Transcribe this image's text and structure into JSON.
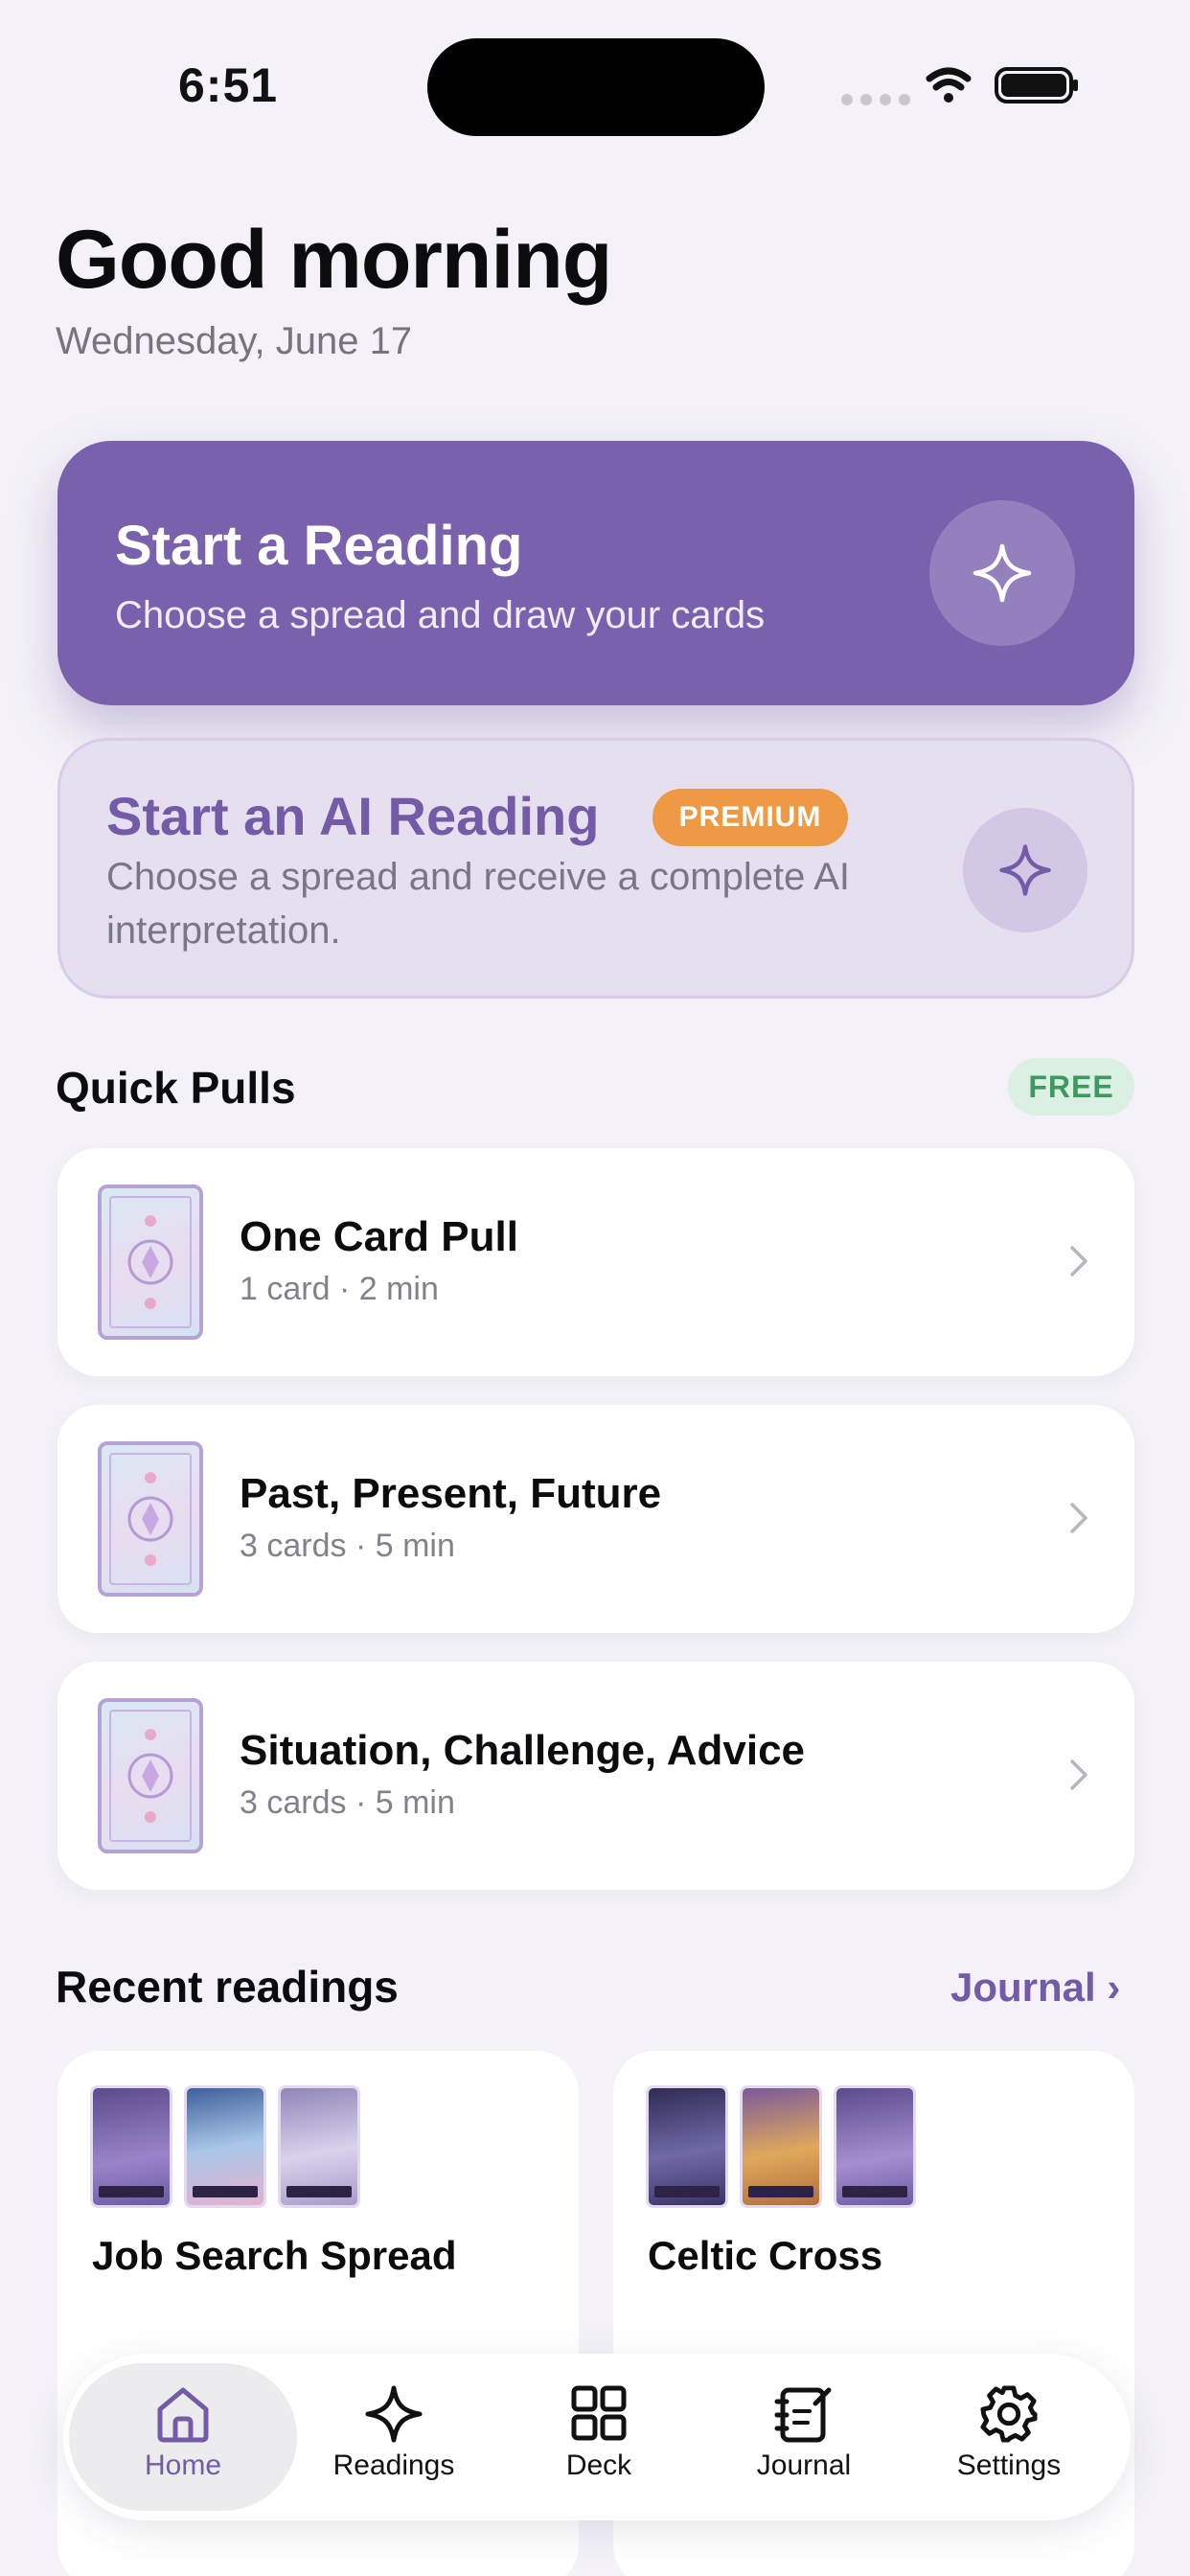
{
  "status_bar": {
    "time": "6:51"
  },
  "header": {
    "title": "Good morning",
    "date": "Wednesday, June 17"
  },
  "start_reading": {
    "title": "Start a Reading",
    "subtitle": "Choose a spread and draw your cards"
  },
  "ai_reading": {
    "title": "Start an AI Reading",
    "badge": "PREMIUM",
    "subtitle": "Choose a spread and receive a complete AI interpretation."
  },
  "quick_pulls": {
    "title": "Quick Pulls",
    "badge": "FREE",
    "items": [
      {
        "title": "One Card Pull",
        "meta": "1 card · 2 min"
      },
      {
        "title": "Past, Present, Future",
        "meta": "3 cards · 5 min"
      },
      {
        "title": "Situation, Challenge, Advice",
        "meta": "3 cards · 5 min"
      }
    ]
  },
  "recent": {
    "title": "Recent readings",
    "link": "Journal ›",
    "cards": [
      {
        "title": "Job Search Spread"
      },
      {
        "title": "Celtic Cross"
      }
    ]
  },
  "tabs": [
    {
      "label": "Home",
      "icon": "home-icon",
      "active": true
    },
    {
      "label": "Readings",
      "icon": "sparkle-icon"
    },
    {
      "label": "Deck",
      "icon": "grid-icon"
    },
    {
      "label": "Journal",
      "icon": "notebook-icon"
    },
    {
      "label": "Settings",
      "icon": "gear-icon"
    }
  ],
  "colors": {
    "accent": "#7a61ad",
    "premium": "#ee9a44",
    "free": "#3c9a60",
    "background": "#f4f2f8"
  }
}
